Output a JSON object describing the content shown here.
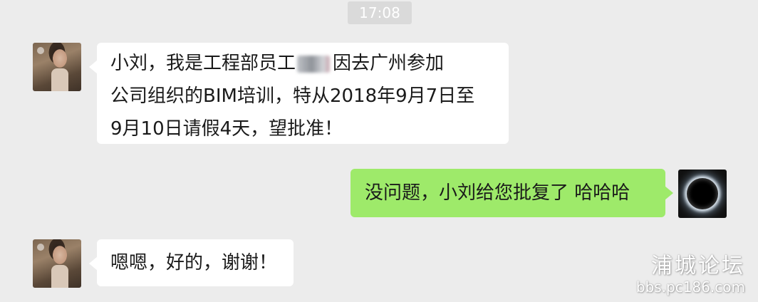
{
  "status": {
    "timestamp": "17:08"
  },
  "messages": [
    {
      "sender": "contact",
      "avatar": "girl-avatar",
      "lines": [
        {
          "before": "小刘，我是工程部员工",
          "after": "因去广州参加"
        },
        {
          "text": "公司组织的BIM培训，特从2018年9月7日至"
        },
        {
          "text": "9月10日请假4天，望批准！"
        }
      ]
    },
    {
      "sender": "self",
      "avatar": "eclipse-avatar",
      "text": "没问题，小刘给您批复了 哈哈哈"
    },
    {
      "sender": "contact",
      "avatar": "girl-avatar",
      "text": "嗯嗯，好的，谢谢！"
    }
  ],
  "watermark": {
    "title": "浦城论坛",
    "url": "bbs.pc186.com"
  },
  "colors": {
    "background": "#ececec",
    "incoming_bubble": "#ffffff",
    "outgoing_bubble": "#9eea6a",
    "timestamp_bg": "#dadada"
  }
}
